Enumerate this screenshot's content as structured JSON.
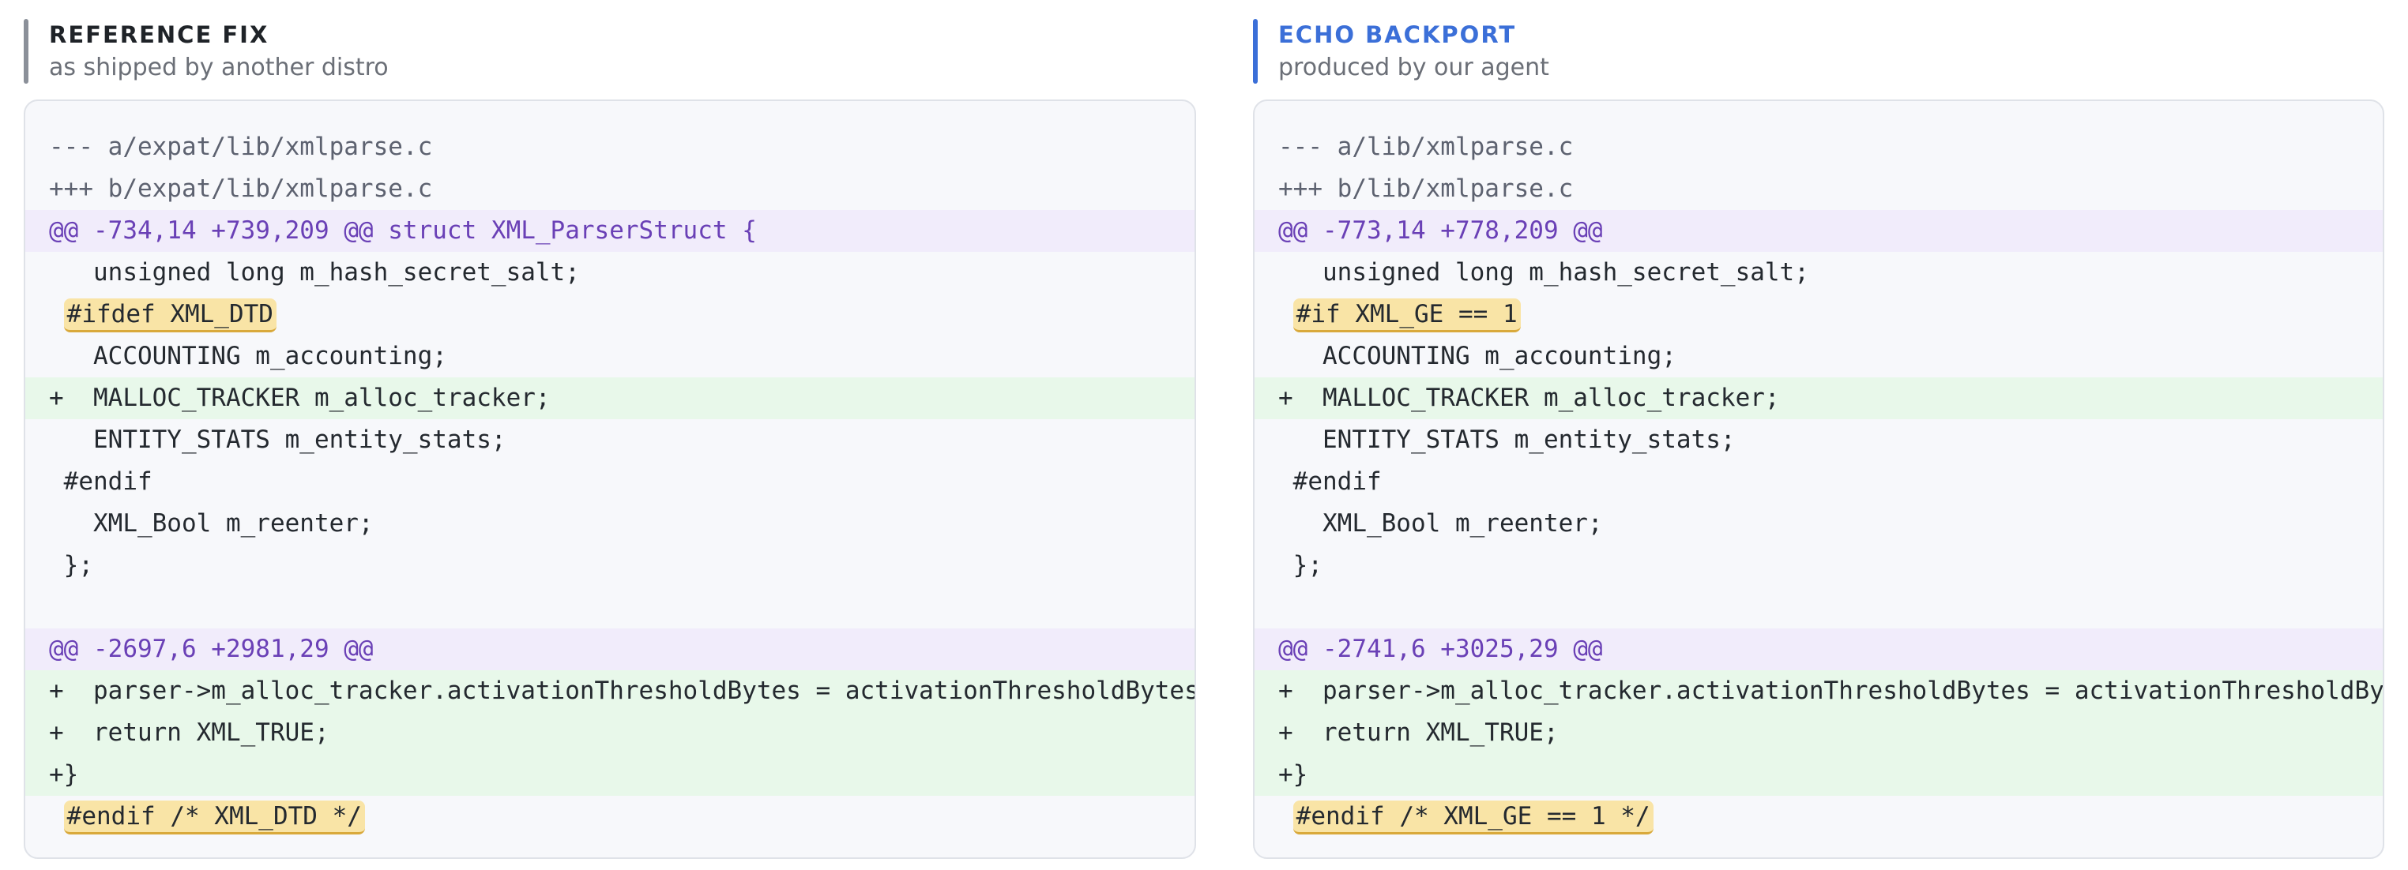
{
  "left_panel": {
    "title": "REFERENCE FIX",
    "subtitle": "as shipped by another distro",
    "accent_color": "#8b9099",
    "lines": [
      {
        "type": "meta",
        "text": "--- a/expat/lib/xmlparse.c"
      },
      {
        "type": "meta",
        "text": "+++ b/expat/lib/xmlparse.c"
      },
      {
        "type": "hunk",
        "text": "@@ -734,14 +739,209 @@ struct XML_ParserStruct {"
      },
      {
        "type": "ctx",
        "text": "   unsigned long m_hash_secret_salt;"
      },
      {
        "type": "ctx-mark",
        "prefix": " ",
        "mark": "#ifdef XML_DTD"
      },
      {
        "type": "ctx",
        "text": "   ACCOUNTING m_accounting;"
      },
      {
        "type": "add",
        "text": "+  MALLOC_TRACKER m_alloc_tracker;"
      },
      {
        "type": "ctx",
        "text": "   ENTITY_STATS m_entity_stats;"
      },
      {
        "type": "ctx",
        "text": " #endif"
      },
      {
        "type": "ctx",
        "text": "   XML_Bool m_reenter;"
      },
      {
        "type": "ctx",
        "text": " };"
      },
      {
        "type": "blank",
        "text": ""
      },
      {
        "type": "hunk",
        "text": "@@ -2697,6 +2981,29 @@"
      },
      {
        "type": "add",
        "text": "+  parser->m_alloc_tracker.activationThresholdBytes = activationThresholdBytes;"
      },
      {
        "type": "add",
        "text": "+  return XML_TRUE;"
      },
      {
        "type": "add",
        "text": "+}"
      },
      {
        "type": "ctx-mark",
        "prefix": " ",
        "mark": "#endif /* XML_DTD */"
      }
    ]
  },
  "right_panel": {
    "title": "ECHO BACKPORT",
    "subtitle": "produced by our agent",
    "accent_color": "#3b6fd8",
    "lines": [
      {
        "type": "meta",
        "text": "--- a/lib/xmlparse.c"
      },
      {
        "type": "meta",
        "text": "+++ b/lib/xmlparse.c"
      },
      {
        "type": "hunk",
        "text": "@@ -773,14 +778,209 @@"
      },
      {
        "type": "ctx",
        "text": "   unsigned long m_hash_secret_salt;"
      },
      {
        "type": "ctx-mark",
        "prefix": " ",
        "mark": "#if XML_GE == 1"
      },
      {
        "type": "ctx",
        "text": "   ACCOUNTING m_accounting;"
      },
      {
        "type": "add",
        "text": "+  MALLOC_TRACKER m_alloc_tracker;"
      },
      {
        "type": "ctx",
        "text": "   ENTITY_STATS m_entity_stats;"
      },
      {
        "type": "ctx",
        "text": " #endif"
      },
      {
        "type": "ctx",
        "text": "   XML_Bool m_reenter;"
      },
      {
        "type": "ctx",
        "text": " };"
      },
      {
        "type": "blank",
        "text": ""
      },
      {
        "type": "hunk",
        "text": "@@ -2741,6 +3025,29 @@"
      },
      {
        "type": "add",
        "text": "+  parser->m_alloc_tracker.activationThresholdBytes = activationThresholdBytes;"
      },
      {
        "type": "add",
        "text": "+  return XML_TRUE;"
      },
      {
        "type": "add",
        "text": "+}"
      },
      {
        "type": "ctx-mark",
        "prefix": " ",
        "mark": "#endif /* XML_GE == 1 */"
      }
    ]
  }
}
